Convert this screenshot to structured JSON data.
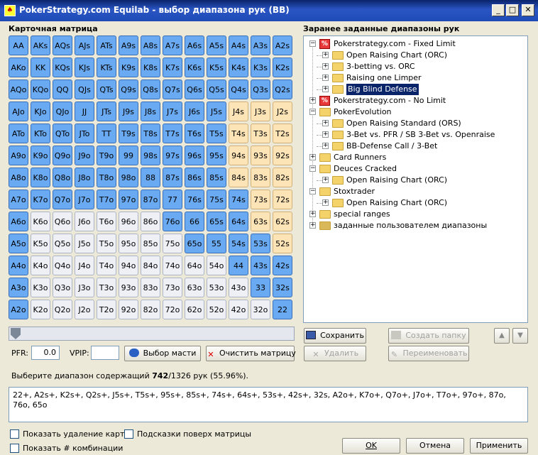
{
  "window": {
    "title": "PokerStrategy.com Equilab - выбор диапазона рук (BB)",
    "minimize": "_",
    "maximize": "□",
    "close": "✕",
    "app_icon": "♠"
  },
  "matrix": {
    "title": "Карточная матрица",
    "rows": [
      [
        "AA",
        "AKs",
        "AQs",
        "AJs",
        "ATs",
        "A9s",
        "A8s",
        "A7s",
        "A6s",
        "A5s",
        "A4s",
        "A3s",
        "A2s"
      ],
      [
        "AKo",
        "KK",
        "KQs",
        "KJs",
        "KTs",
        "K9s",
        "K8s",
        "K7s",
        "K6s",
        "K5s",
        "K4s",
        "K3s",
        "K2s"
      ],
      [
        "AQo",
        "KQo",
        "QQ",
        "QJs",
        "QTs",
        "Q9s",
        "Q8s",
        "Q7s",
        "Q6s",
        "Q5s",
        "Q4s",
        "Q3s",
        "Q2s"
      ],
      [
        "AJo",
        "KJo",
        "QJo",
        "JJ",
        "JTs",
        "J9s",
        "J8s",
        "J7s",
        "J6s",
        "J5s",
        "J4s",
        "J3s",
        "J2s"
      ],
      [
        "ATo",
        "KTo",
        "QTo",
        "JTo",
        "TT",
        "T9s",
        "T8s",
        "T7s",
        "T6s",
        "T5s",
        "T4s",
        "T3s",
        "T2s"
      ],
      [
        "A9o",
        "K9o",
        "Q9o",
        "J9o",
        "T9o",
        "99",
        "98s",
        "97s",
        "96s",
        "95s",
        "94s",
        "93s",
        "92s"
      ],
      [
        "A8o",
        "K8o",
        "Q8o",
        "J8o",
        "T8o",
        "98o",
        "88",
        "87s",
        "86s",
        "85s",
        "84s",
        "83s",
        "82s"
      ],
      [
        "A7o",
        "K7o",
        "Q7o",
        "J7o",
        "T7o",
        "97o",
        "87o",
        "77",
        "76s",
        "75s",
        "74s",
        "73s",
        "72s"
      ],
      [
        "A6o",
        "K6o",
        "Q6o",
        "J6o",
        "T6o",
        "96o",
        "86o",
        "76o",
        "66",
        "65s",
        "64s",
        "63s",
        "62s"
      ],
      [
        "A5o",
        "K5o",
        "Q5o",
        "J5o",
        "T5o",
        "95o",
        "85o",
        "75o",
        "65o",
        "55",
        "54s",
        "53s",
        "52s"
      ],
      [
        "A4o",
        "K4o",
        "Q4o",
        "J4o",
        "T4o",
        "94o",
        "84o",
        "74o",
        "64o",
        "54o",
        "44",
        "43s",
        "42s"
      ],
      [
        "A3o",
        "K3o",
        "Q3o",
        "J3o",
        "T3o",
        "93o",
        "83o",
        "73o",
        "63o",
        "53o",
        "43o",
        "33",
        "32s"
      ],
      [
        "A2o",
        "K2o",
        "Q2o",
        "J2o",
        "T2o",
        "92o",
        "82o",
        "72o",
        "62o",
        "52o",
        "42o",
        "32o",
        "22"
      ]
    ],
    "states": [
      "SSSSSSSSSSSSS",
      "SSSSSSSSSSSSS",
      "SSSSSSSSSSSSS",
      "SSSSSSSSSSYYY",
      "SSSSSSSSSSYYY",
      "SSSSSSSSSSYYY",
      "SSSSSSSSSSYYY",
      "SSSSSSSSSSSYY",
      "SUUUUUUSSSSYY",
      "SUUUUUUUSSSSY",
      "SUUUUUUUUUSSS",
      "SUUUUUUUUUUSS",
      "SUUUUUUUUUUUS"
    ],
    "colors": {
      "S": "#6aaaf2",
      "U": "#eef0f6",
      "Y": "#fce4b6"
    }
  },
  "controls": {
    "pfr_label": "PFR:",
    "pfr_value": "0.0",
    "vpip_label": "VPIP:",
    "vpip_value": "",
    "suit_button": "Выбор масти",
    "clear_button": "Очистить матрицу"
  },
  "tree": {
    "title": "Заранее заданные диапазоны рук",
    "nodes": [
      {
        "depth": 0,
        "exp": "−",
        "icon": "ps",
        "label": "Pokerstrategy.com - Fixed Limit"
      },
      {
        "depth": 1,
        "exp": "+",
        "icon": "folder",
        "label": "Open Raising Chart (ORC)"
      },
      {
        "depth": 1,
        "exp": "+",
        "icon": "folder",
        "label": "3-betting vs. ORC"
      },
      {
        "depth": 1,
        "exp": "+",
        "icon": "folder",
        "label": "Raising one Limper"
      },
      {
        "depth": 1,
        "exp": "+",
        "icon": "folder",
        "label": "Big Blind Defense",
        "selected": true
      },
      {
        "depth": 0,
        "exp": "+",
        "icon": "ps",
        "label": "Pokerstrategy.com - No Limit"
      },
      {
        "depth": 0,
        "exp": "−",
        "icon": "folder",
        "label": "PokerEvolution"
      },
      {
        "depth": 1,
        "exp": "+",
        "icon": "folder",
        "label": "Open Raising Standard (ORS)"
      },
      {
        "depth": 1,
        "exp": "+",
        "icon": "folder",
        "label": "3-Bet vs. PFR / SB 3-Bet vs. Openraise"
      },
      {
        "depth": 1,
        "exp": "+",
        "icon": "folder",
        "label": "BB-Defense Call / 3-Bet"
      },
      {
        "depth": 0,
        "exp": "+",
        "icon": "folder",
        "label": "Card Runners"
      },
      {
        "depth": 0,
        "exp": "−",
        "icon": "folder",
        "label": "Deuces Cracked"
      },
      {
        "depth": 1,
        "exp": "+",
        "icon": "folder",
        "label": "Open Raising Chart (ORC)"
      },
      {
        "depth": 0,
        "exp": "−",
        "icon": "folder",
        "label": "Stoxtrader"
      },
      {
        "depth": 1,
        "exp": "+",
        "icon": "folder",
        "label": "Open Raising Chart (ORC)"
      },
      {
        "depth": 0,
        "exp": "+",
        "icon": "folder",
        "label": "special ranges"
      },
      {
        "depth": 0,
        "exp": "+",
        "icon": "userfolder",
        "label": "заданные пользователем диапазоны"
      }
    ]
  },
  "tree_buttons": {
    "save": "Сохранить",
    "create_folder": "Создать папку",
    "delete": "Удалить",
    "rename": "Переименовать",
    "up": "▲",
    "down": "▼"
  },
  "summary": {
    "prefix": "Выберите диапазон содержащий ",
    "selected": "742",
    "rest": "/1326 рук (55.96%)."
  },
  "range_text": "22+, A2s+, K2s+, Q2s+, J5s+, T5s+, 95s+, 85s+, 74s+, 64s+, 53s+, 42s+, 32s, A2o+, K7o+, Q7o+, J7o+, T7o+, 97o+, 87o, 76o, 65o",
  "options": {
    "show_card_removal": "Показать удаление карт",
    "hints_over_matrix": "Подсказки поверх матрицы",
    "show_combos": "Показать # комбинации"
  },
  "footer": {
    "ok": "OK",
    "cancel": "Отмена",
    "apply": "Применить"
  }
}
